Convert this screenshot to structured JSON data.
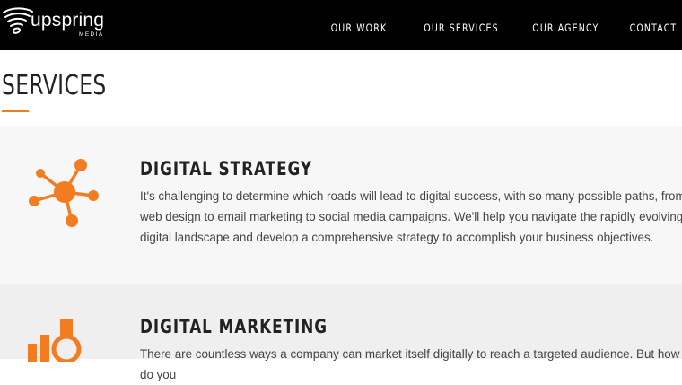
{
  "brand": {
    "name": "upspring",
    "subtitle": "MEDIA",
    "accent_color": "#f47c20"
  },
  "nav": {
    "items": [
      {
        "label": "OUR WORK"
      },
      {
        "label": "OUR SERVICES"
      },
      {
        "label": "OUR AGENCY"
      },
      {
        "label": "CONTACT"
      }
    ]
  },
  "page": {
    "title": "SERVICES"
  },
  "services": [
    {
      "icon": "network-nodes-icon",
      "title": "DIGITAL STRATEGY",
      "description": "It's challenging to determine which roads will lead to digital success, with so many possible paths, from web design to email marketing to social media campaigns. We'll help you navigate the rapidly evolving digital landscape and develop a comprehensive strategy to accomplish your business objectives."
    },
    {
      "icon": "bar-chart-magnifier-icon",
      "title": "DIGITAL MARKETING",
      "description": "There are countless ways a company can market itself digitally to reach a targeted audience. But how do you"
    }
  ]
}
